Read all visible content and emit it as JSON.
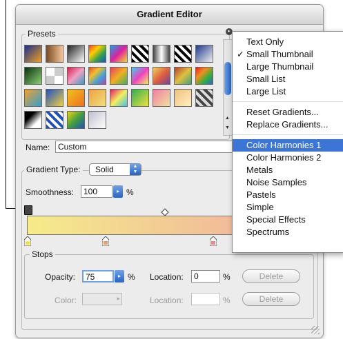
{
  "window": {
    "title": "Gradient Editor"
  },
  "presets": {
    "label": "Presets",
    "swatches": [
      "linear-gradient(135deg,#1d2f8a,#f0a020)",
      "linear-gradient(90deg,#7a4a20,#f2c69a)",
      "linear-gradient(135deg,#222,#fff)",
      "linear-gradient(135deg,#f04020,#ffd000,#30a050,#2050d0)",
      "linear-gradient(135deg,#20a0e0,#e020a0,#f0e020)",
      "repeating-linear-gradient(45deg,#000 0 4px,#fff 4px 8px)",
      "linear-gradient(90deg,#444,#fff,#444)",
      "repeating-linear-gradient(45deg,#000 0 4px,#fff 4px 8px)",
      "linear-gradient(135deg,#203a8a,#f0f0f0)",
      "linear-gradient(135deg,#0a3010,#8ad070)",
      "repeating-conic-gradient(#ccc 0 25%,#fff 0 50%)",
      "linear-gradient(135deg,#d02050,#f0a0c0,#30a0d0)",
      "linear-gradient(135deg,#e05020,#f0c030,#40a0e0,#c040a0)",
      "linear-gradient(135deg,#e04060,#f0b020,#40b060)",
      "linear-gradient(135deg,#40d0f0,#f040c0,#f0f060)",
      "linear-gradient(135deg,#f0d060,#e06040,#7040a0)",
      "linear-gradient(135deg,#b04030,#e0c040,#40a080)",
      "linear-gradient(135deg,#e02020,#f09020,#30b040,#3060e0)",
      "linear-gradient(135deg,#f0a030,#30a0d0)",
      "linear-gradient(135deg,#2050c0,#f0d040)",
      "linear-gradient(135deg,#f0c020,#f07020)",
      "linear-gradient(135deg,#f0a040,#f0e080)",
      "linear-gradient(135deg,#e02060,#f0f060,#40c0f0)",
      "linear-gradient(135deg,#30b050,#f0e040)",
      "linear-gradient(135deg,#f080a0,#f0e0a0)",
      "linear-gradient(135deg,#f0c080,#fff0c0)",
      "repeating-linear-gradient(45deg,#444 0 4px,#ddd 4px 8px)",
      "linear-gradient(135deg,#000 30%,#fff 70%)",
      "repeating-linear-gradient(45deg,#2050c0 0 4px,#fff 4px 8px)",
      "linear-gradient(135deg,#f0d020,#40a040,#2050c0)",
      "linear-gradient(135deg,#c0c0d0,#fff)"
    ]
  },
  "name": {
    "label": "Name:",
    "value": "Custom"
  },
  "gradient_type": {
    "label": "Gradient Type:",
    "value": "Solid"
  },
  "smoothness": {
    "label": "Smoothness:",
    "value": "100",
    "unit": "%"
  },
  "stops": {
    "label": "Stops",
    "opacity_label": "Opacity:",
    "opacity_value": "75",
    "opacity_unit": "%",
    "location_label": "Location:",
    "location_value": "0",
    "location_unit": "%",
    "delete_label": "Delete",
    "color_label": "Color:",
    "location2_label": "Location:",
    "location2_unit": "%",
    "delete2_label": "Delete"
  },
  "menu": {
    "items": [
      {
        "label": "Text Only",
        "check": ""
      },
      {
        "label": "Small Thumbnail",
        "check": "✓"
      },
      {
        "label": "Large Thumbnail",
        "check": ""
      },
      {
        "label": "Small List",
        "check": ""
      },
      {
        "label": "Large List",
        "check": ""
      },
      {
        "label": "Reset Gradients...",
        "check": ""
      },
      {
        "label": "Replace Gradients...",
        "check": ""
      },
      {
        "label": "Color Harmonies 1",
        "check": ""
      },
      {
        "label": "Color Harmonies 2",
        "check": ""
      },
      {
        "label": "Metals",
        "check": ""
      },
      {
        "label": "Noise Samples",
        "check": ""
      },
      {
        "label": "Pastels",
        "check": ""
      },
      {
        "label": "Simple",
        "check": ""
      },
      {
        "label": "Special Effects",
        "check": ""
      },
      {
        "label": "Spectrums",
        "check": ""
      }
    ]
  },
  "colors": {
    "accent": "#3b76d6",
    "gradient_start": "#f5ec8a",
    "gradient_end": "#f0a8a0"
  }
}
